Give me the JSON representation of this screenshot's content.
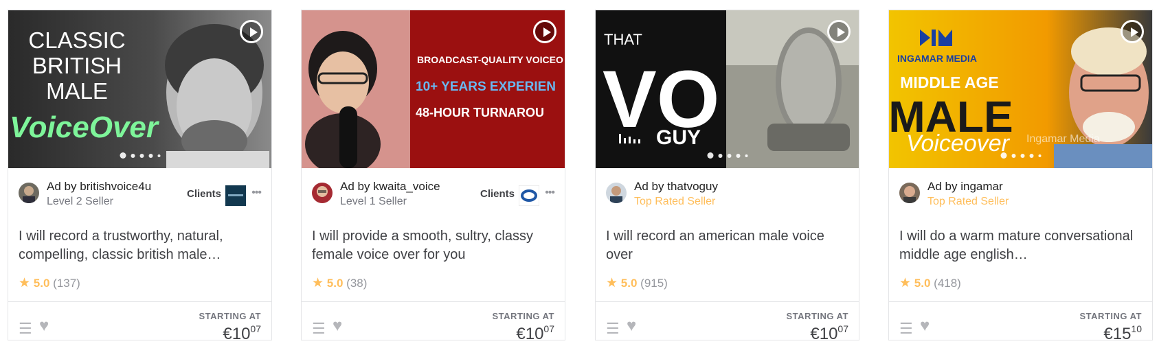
{
  "colors": {
    "top_rated": "#ffbe5b",
    "star": "#ffbe5b",
    "border": "#e4e5e7"
  },
  "gigs": [
    {
      "thumb": {
        "line1": "CLASSIC",
        "line2": "BRITISH",
        "line3": "MALE",
        "script": "VoiceOver"
      },
      "ad_prefix": "Ad by",
      "seller": "britishvoice4u",
      "level": "Level 2 Seller",
      "clients_label": "Clients",
      "more": "•••",
      "title": "I will record a trustworthy, natural, compelling, classic british male…",
      "rating": "5.0",
      "reviews": "(137)",
      "starting_label": "STARTING AT",
      "price_main": "€10",
      "price_cents": "07"
    },
    {
      "thumb": {
        "line1": "BROADCAST-QUALITY VOICEO",
        "line2": "10+ YEARS EXPERIEN",
        "line3": "48-HOUR TURNAROU"
      },
      "ad_prefix": "Ad by",
      "seller": "kwaita_voice",
      "level": "Level 1 Seller",
      "clients_label": "Clients",
      "more": "•••",
      "title": "I will provide a smooth, sultry, classy female voice over for you",
      "rating": "5.0",
      "reviews": "(38)",
      "starting_label": "STARTING AT",
      "price_main": "€10",
      "price_cents": "07"
    },
    {
      "thumb": {
        "line1": "THAT",
        "line2": "VO",
        "line3": "GUY"
      },
      "ad_prefix": "Ad by",
      "seller": "thatvoguy",
      "level": "Top Rated Seller",
      "title": "I will record an american male voice over",
      "rating": "5.0",
      "reviews": "(915)",
      "starting_label": "STARTING AT",
      "price_main": "€10",
      "price_cents": "07"
    },
    {
      "thumb": {
        "brand": "INGAMAR MEDIA",
        "line1": "MIDDLE AGE",
        "line2": "MALE",
        "script": "Voiceover",
        "watermark": "Ingamar Media"
      },
      "ad_prefix": "Ad by",
      "seller": "ingamar",
      "level": "Top Rated Seller",
      "title": "I will do a warm mature conversational middle age english…",
      "rating": "5.0",
      "reviews": "(418)",
      "starting_label": "STARTING AT",
      "price_main": "€15",
      "price_cents": "10"
    }
  ]
}
